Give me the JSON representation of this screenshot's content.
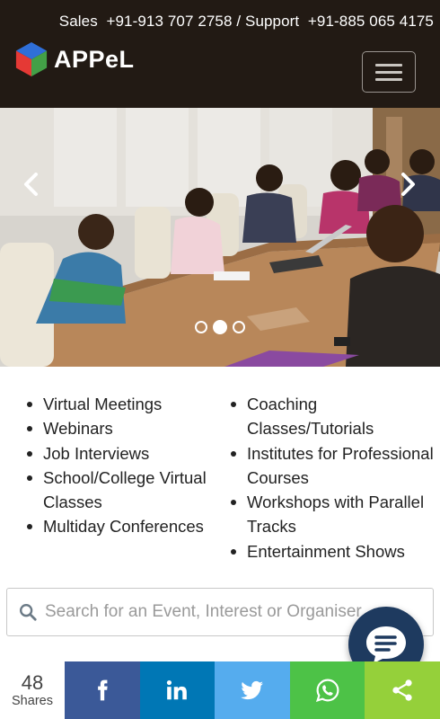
{
  "header": {
    "contact_text": "Sales  +91-913 707 2758 / Support  +91-885 065 4175",
    "brand": "APPeL",
    "menu_icon": "hamburger-icon"
  },
  "carousel": {
    "prev_icon": "chevron-left-icon",
    "next_icon": "chevron-right-icon",
    "slide_count": 3,
    "active_slide": 2
  },
  "features": {
    "left": [
      "Virtual Meetings",
      "Webinars",
      "Job Interviews",
      "School/College Virtual Classes",
      "Multiday Conferences"
    ],
    "right": [
      "Coaching Classes/Tutorials",
      "Institutes for Professional Courses",
      "Workshops with Parallel Tracks",
      "Entertainment Shows"
    ]
  },
  "search": {
    "placeholder": "Search for an Event, Interest or Organiser",
    "icon": "search-icon"
  },
  "chat": {
    "icon": "chat-icon"
  },
  "share": {
    "count": "48",
    "label": "Shares",
    "buttons": [
      {
        "name": "facebook",
        "icon": "facebook-icon",
        "color": "#3b5998"
      },
      {
        "name": "linkedin",
        "icon": "linkedin-icon",
        "color": "#0077b5"
      },
      {
        "name": "twitter",
        "icon": "twitter-icon",
        "color": "#55acee"
      },
      {
        "name": "whatsapp",
        "icon": "whatsapp-icon",
        "color": "#4dc247"
      },
      {
        "name": "share",
        "icon": "share-icon",
        "color": "#95d03a"
      }
    ]
  },
  "colors": {
    "header_bg": "#221a14",
    "chat_bg": "#1e3a5f"
  }
}
